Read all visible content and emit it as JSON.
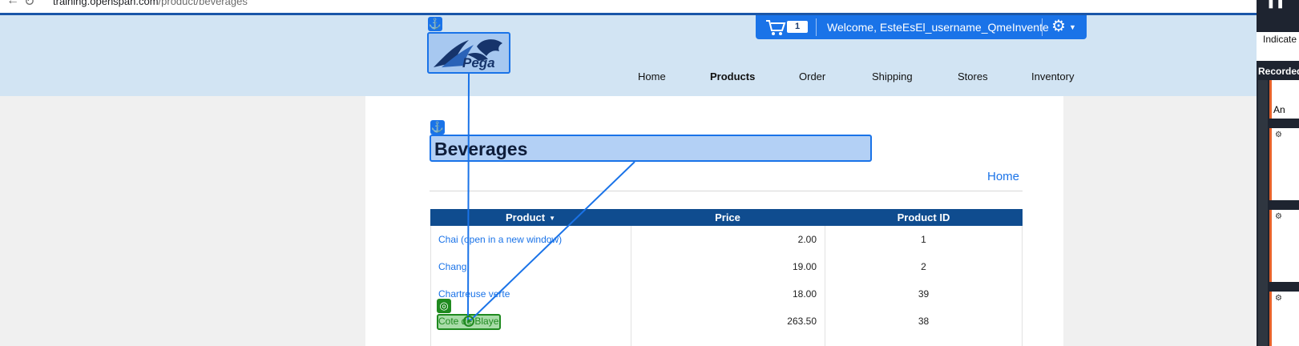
{
  "browser": {
    "url_host": "training.openspan.com",
    "url_path": "/product/beverages"
  },
  "header": {
    "logo_text": "Pega",
    "cart_count": "1",
    "welcome": "Welcome, EsteEsEl_username_QmeInvente",
    "nav": [
      {
        "label": "Home"
      },
      {
        "label": "Products"
      },
      {
        "label": "Order"
      },
      {
        "label": "Shipping"
      },
      {
        "label": "Stores"
      },
      {
        "label": "Inventory"
      }
    ]
  },
  "page": {
    "title": "Beverages",
    "home_link": "Home"
  },
  "table": {
    "columns": [
      "Product",
      "Price",
      "Product ID"
    ],
    "rows": [
      {
        "name": "Chai  (open in a new window)",
        "price": "2.00",
        "id": "1"
      },
      {
        "name": "Chang",
        "price": "19.00",
        "id": "2"
      },
      {
        "name": "Chartreuse verte",
        "price": "18.00",
        "id": "39"
      },
      {
        "name": "Cote de Blaye",
        "price": "263.50",
        "id": "38"
      }
    ]
  },
  "side_panel": {
    "indicate_label": "Indicate",
    "recorded_label": "Recorded",
    "card_label": "An"
  },
  "colors": {
    "accent": "#1a73e8",
    "header_bg": "#d2e4f3",
    "table_header": "#0f4c8f",
    "selection_green": "#1f8a1f"
  }
}
